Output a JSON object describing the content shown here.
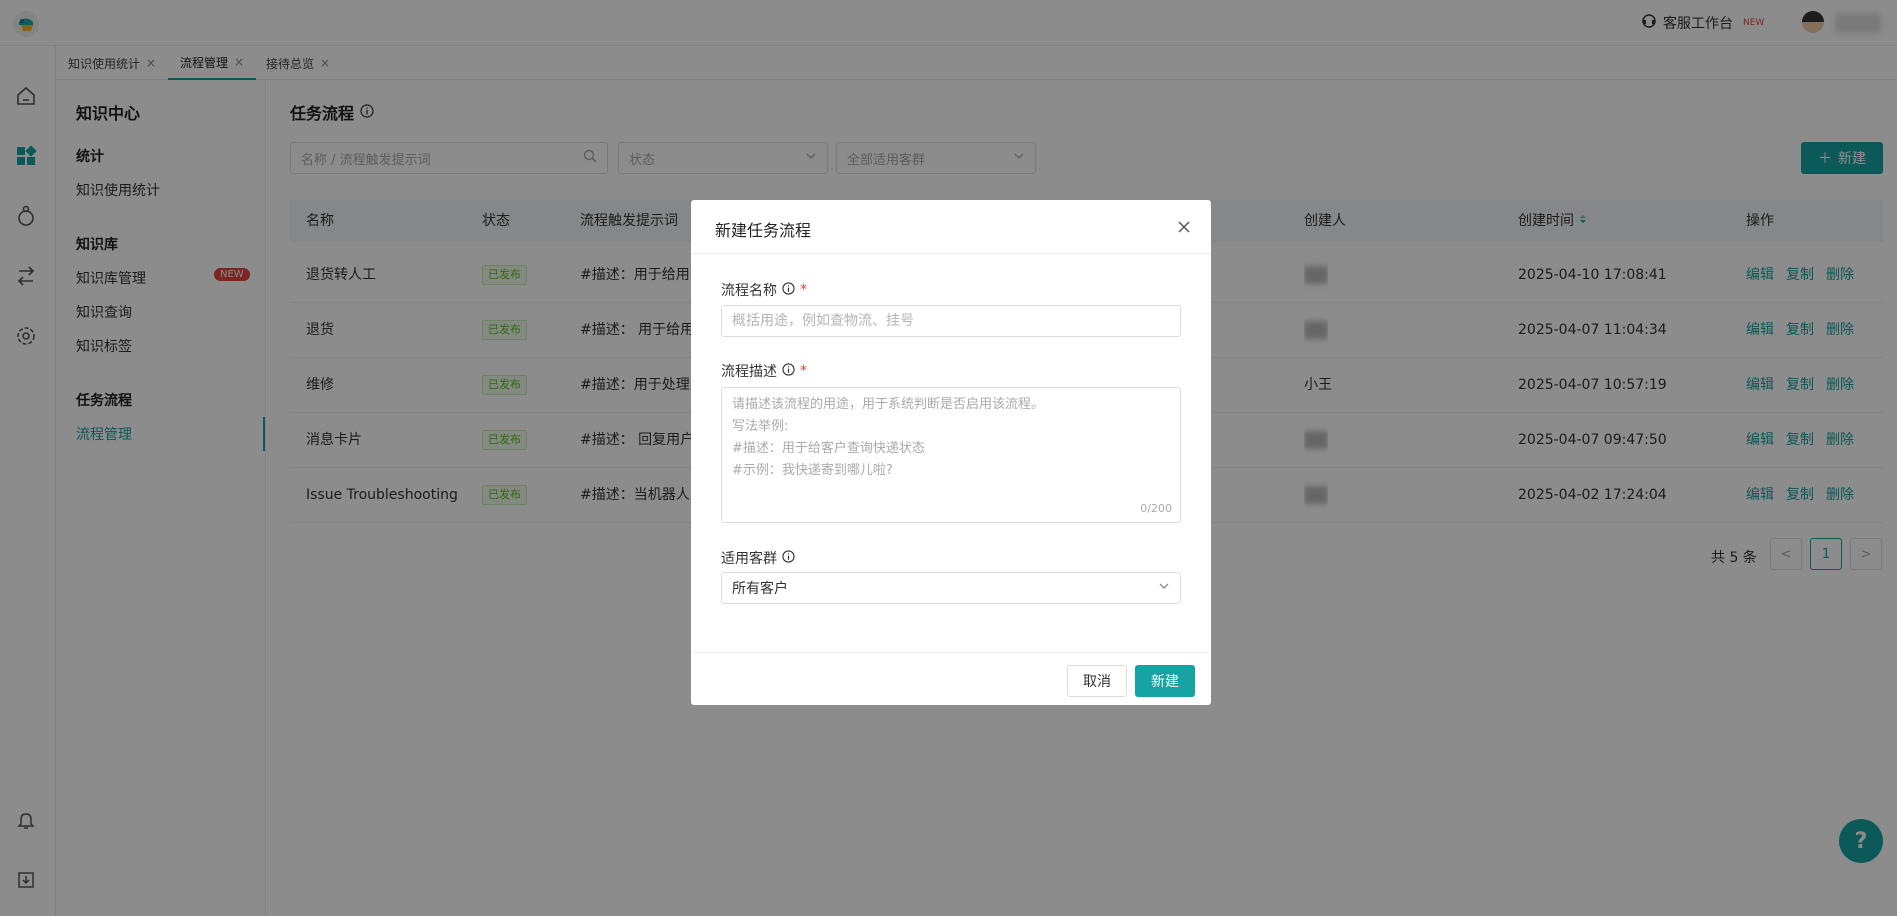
{
  "header": {
    "cs_workbench_label": "客服工作台",
    "cs_new_tag": "NEW"
  },
  "tabs": [
    {
      "label": "知识使用统计",
      "close": "×"
    },
    {
      "label": "流程管理",
      "close": "×"
    },
    {
      "label": "接待总览",
      "close": "×"
    }
  ],
  "subnav": {
    "title": "知识中心",
    "group_stats": "统计",
    "item_usage": "知识使用统计",
    "group_kb": "知识库",
    "item_kb_manage": "知识库管理",
    "badge_new": "NEW",
    "item_query": "知识查询",
    "item_tags": "知识标签",
    "group_flow": "任务流程",
    "item_flow_manage": "流程管理"
  },
  "main": {
    "page_title": "任务流程",
    "search_placeholder": "名称 / 流程触发提示词",
    "status_filter": "状态",
    "audience_filter": "全部适用客群",
    "new_button": "新建",
    "columns": [
      "名称",
      "状态",
      "流程触发提示词",
      "创建人",
      "创建时间",
      "操作"
    ],
    "rows": [
      {
        "name": "退货转人工",
        "status": "已发布",
        "prompt": "#描述：用于给用",
        "creator": "",
        "created": "2025-04-10 17:08:41"
      },
      {
        "name": "退货",
        "status": "已发布",
        "prompt": "#描述： 用于给用",
        "creator": "",
        "created": "2025-04-07 11:04:34"
      },
      {
        "name": "维修",
        "status": "已发布",
        "prompt": "#描述：用于处理",
        "creator": "小王",
        "created": "2025-04-07 10:57:19"
      },
      {
        "name": "消息卡片",
        "status": "已发布",
        "prompt": "#描述： 回复用户",
        "creator": "",
        "created": "2025-04-07 09:47:50"
      },
      {
        "name": "Issue Troubleshooting",
        "status": "已发布",
        "prompt": "#描述：当机器人",
        "creator": "",
        "created": "2025-04-02 17:24:04"
      }
    ],
    "actions": {
      "edit": "编辑",
      "copy": "复制",
      "delete": "删除"
    },
    "pager": {
      "total": "共 5 条",
      "prev": "<",
      "current": "1",
      "next": ">"
    }
  },
  "modal": {
    "title": "新建任务流程",
    "name_label": "流程名称",
    "name_placeholder": "概括用途，例如查物流、挂号",
    "desc_label": "流程描述",
    "desc_placeholder_lines": [
      "请描述该流程的用途，用于系统判断是否启用该流程。",
      "写法举例:",
      "#描述：用于给客户查询快递状态",
      "#示例：我快递寄到哪儿啦?"
    ],
    "desc_counter": "0/200",
    "audience_label": "适用客群",
    "audience_value": "所有客户",
    "required_mark": "*",
    "cancel": "取消",
    "create": "新建"
  },
  "help_fab": "?",
  "colors": {
    "accent": "#15a3a3",
    "danger": "#e0463b",
    "success": "#52c41a"
  }
}
